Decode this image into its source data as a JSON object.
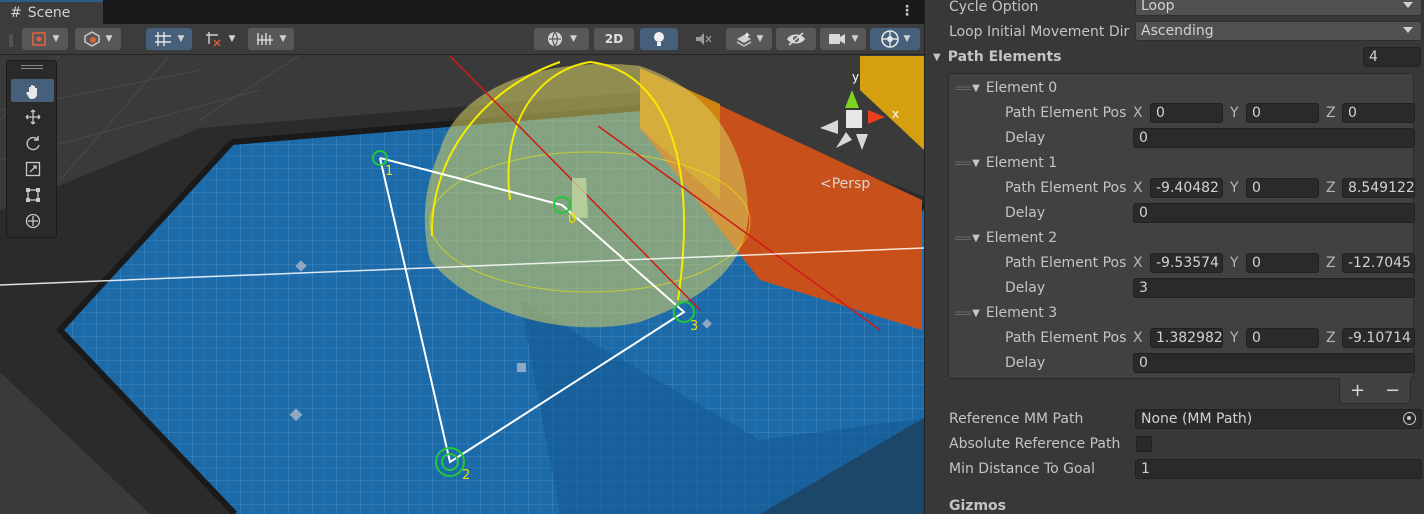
{
  "scene": {
    "tab_label": "Scene",
    "view_2d_label": "2D",
    "persp_label": "Persp",
    "gizmo_axes": {
      "x": "x",
      "y": "y"
    },
    "waypoint_labels": [
      "0",
      "1",
      "2",
      "3"
    ],
    "colors": {
      "accent": "#46607c",
      "floor": "#1f6fae",
      "path": "#ffffff",
      "waypoint": "#22c83a",
      "range_sphere": "#e8e000",
      "wall": "#c8501a"
    }
  },
  "toolbar_icons": [
    "draw-mode-icon",
    "shading-icon",
    "grid-snap-icon",
    "increment-snap-icon",
    "ruler-icon",
    "globe-icon",
    "lighting-icon",
    "audio-icon",
    "effects-icon",
    "hidden-objects-icon",
    "camera-icon",
    "gizmos-icon"
  ],
  "tools": [
    "hand-tool-icon",
    "move-tool-icon",
    "rotate-tool-icon",
    "scale-tool-icon",
    "rect-tool-icon",
    "transform-tool-icon"
  ],
  "inspector": {
    "cycle_option": {
      "label": "Cycle Option",
      "value": "Loop"
    },
    "loop_direction": {
      "label": "Loop Initial Movement Dir",
      "value": "Ascending"
    },
    "path_elements": {
      "label": "Path Elements",
      "count": "4",
      "pos_label": "Path Element Pos",
      "delay_label": "Delay",
      "axis_x": "X",
      "axis_y": "Y",
      "axis_z": "Z",
      "items": [
        {
          "name": "Element 0",
          "x": "0",
          "y": "0",
          "z": "0",
          "delay": "0"
        },
        {
          "name": "Element 1",
          "x": "-9.40482",
          "y": "0",
          "z": "8.549122",
          "delay": "0"
        },
        {
          "name": "Element 2",
          "x": "-9.53574",
          "y": "0",
          "z": "-12.7045",
          "delay": "3"
        },
        {
          "name": "Element 3",
          "x": "1.382982",
          "y": "0",
          "z": "-9.10714",
          "delay": "0"
        }
      ]
    },
    "add_label": "+",
    "remove_label": "−",
    "reference_path": {
      "label": "Reference MM Path",
      "value": "None (MM Path)"
    },
    "absolute_reference": {
      "label": "Absolute Reference Path"
    },
    "min_distance": {
      "label": "Min Distance To Goal",
      "value": "1"
    },
    "gizmos_header": "Gizmos"
  }
}
